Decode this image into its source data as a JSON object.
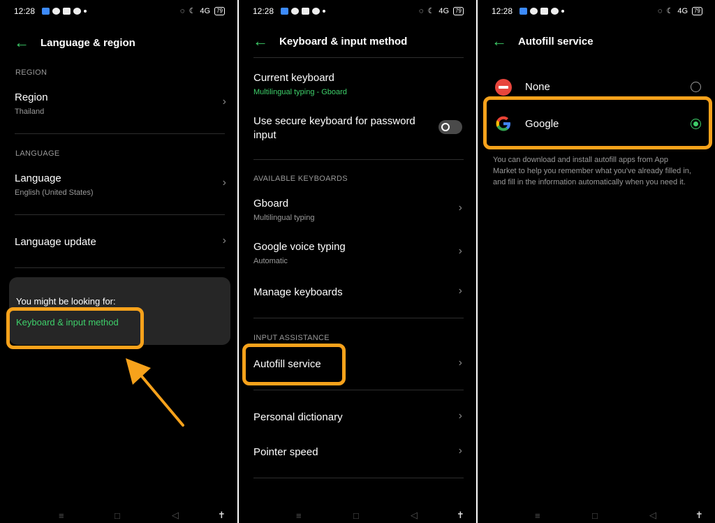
{
  "status": {
    "time": "12:28",
    "battery": "79",
    "signal": "4G"
  },
  "panel1": {
    "title": "Language & region",
    "region_section": "REGION",
    "region": {
      "label": "Region",
      "value": "Thailand"
    },
    "language_section": "LANGUAGE",
    "language": {
      "label": "Language",
      "value": "English (United States)"
    },
    "language_update": "Language update",
    "suggest": {
      "title": "You might be looking for:",
      "link": "Keyboard & input method"
    }
  },
  "panel2": {
    "title": "Keyboard & input method",
    "current_keyboard": {
      "label": "Current keyboard",
      "value": "Multilingual typing - Gboard"
    },
    "secure_keyboard": {
      "label_line1": "Use secure keyboard for password",
      "label_line2": "input",
      "enabled": false
    },
    "available_section": "AVAILABLE KEYBOARDS",
    "keyboards": [
      {
        "label": "Gboard",
        "sub": "Multilingual typing"
      },
      {
        "label": "Google voice typing",
        "sub": "Automatic"
      }
    ],
    "manage_keyboards": "Manage keyboards",
    "assist_section": "INPUT ASSISTANCE",
    "autofill": "Autofill service",
    "personal_dictionary": "Personal dictionary",
    "pointer_speed": "Pointer speed"
  },
  "panel3": {
    "title": "Autofill service",
    "options": [
      {
        "label": "None",
        "selected": false
      },
      {
        "label": "Google",
        "selected": true
      }
    ],
    "description_lines": [
      "You can download and install autofill apps from App",
      "Market to help you remember what you've already filled in,",
      "and fill in the information automatically when you need it."
    ]
  },
  "colors": {
    "accent": "#3ecf6a",
    "highlight": "#f7a21b",
    "background": "#000000"
  }
}
